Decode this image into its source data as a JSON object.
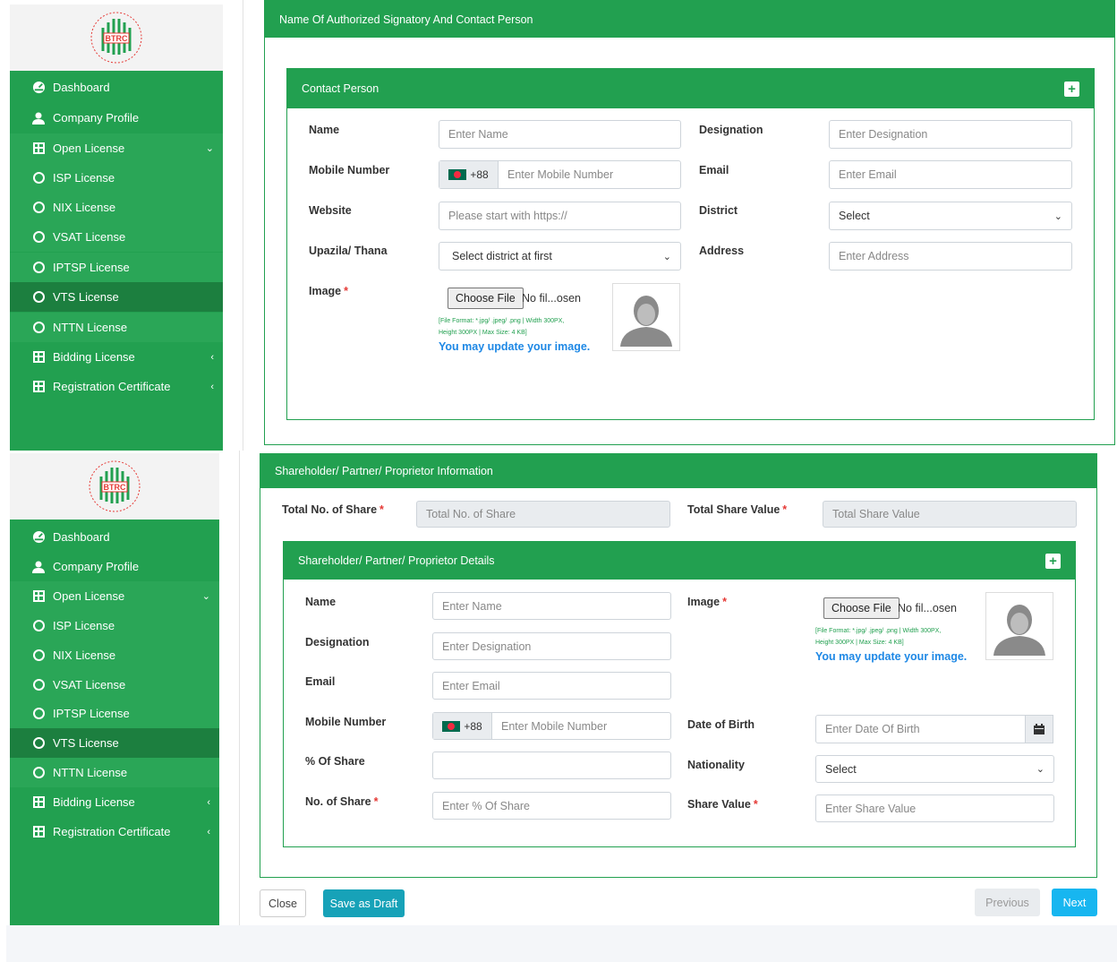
{
  "sidebar": {
    "logo_text": "BTRC",
    "items": [
      {
        "label": "Dashboard",
        "icon": "dashboard-icon"
      },
      {
        "label": "Company Profile",
        "icon": "user-icon"
      },
      {
        "label": "Open License",
        "icon": "plus-square-icon"
      },
      {
        "label": "ISP License",
        "icon": "circle-icon"
      },
      {
        "label": "NIX License",
        "icon": "circle-icon"
      },
      {
        "label": "VSAT License",
        "icon": "circle-icon"
      },
      {
        "label": "IPTSP License",
        "icon": "circle-icon"
      },
      {
        "label": "VTS License",
        "icon": "circle-icon"
      },
      {
        "label": "NTTN License",
        "icon": "circle-icon"
      },
      {
        "label": "Bidding License",
        "icon": "plus-square-icon"
      },
      {
        "label": "Registration Certificate",
        "icon": "plus-square-icon"
      }
    ]
  },
  "section1": {
    "title": "Name Of Authorized Signatory And Contact Person",
    "card_title": "Contact Person",
    "name_label": "Name",
    "name_placeholder": "Enter Name",
    "designation_label": "Designation",
    "designation_placeholder": "Enter Designation",
    "mobile_label": "Mobile Number",
    "country_code": "+88",
    "mobile_placeholder": "Enter Mobile Number",
    "email_label": "Email",
    "email_placeholder": "Enter Email",
    "website_label": "Website",
    "website_placeholder": "Please start with https://",
    "district_label": "District",
    "district_value": "Select",
    "upazila_label": "Upazila/ Thana",
    "upazila_value": "Select district at first",
    "address_label": "Address",
    "address_placeholder": "Enter Address",
    "image_label": "Image",
    "choose_file": "Choose File",
    "file_status": "No fil...osen",
    "hint_line1": "[File Format: *.jpg/ .jpeg/ .png | Width 300PX,",
    "hint_line2": "Height 300PX | Max Size: 4 KB]",
    "update_text": "You may update your image."
  },
  "section2": {
    "title": "Shareholder/ Partner/ Proprietor Information",
    "total_share_label": "Total No. of Share",
    "total_share_placeholder": "Total No. of Share",
    "total_value_label": "Total Share Value",
    "total_value_placeholder": "Total Share Value",
    "card_title": "Shareholder/ Partner/ Proprietor Details",
    "name_label": "Name",
    "name_placeholder": "Enter Name",
    "image_label": "Image",
    "choose_file": "Choose File",
    "file_status": "No fil...osen",
    "hint_line1": "[File Format: *.jpg/ .jpeg/ .png | Width 300PX,",
    "hint_line2": "Height 300PX | Max Size: 4 KB]",
    "update_text": "You may update your image.",
    "designation_label": "Designation",
    "designation_placeholder": "Enter Designation",
    "email_label": "Email",
    "email_placeholder": "Enter Email",
    "mobile_label": "Mobile Number",
    "country_code": "+88",
    "mobile_placeholder": "Enter Mobile Number",
    "dob_label": "Date of Birth",
    "dob_placeholder": "Enter Date Of Birth",
    "percent_label": "% Of Share",
    "percent_value": "",
    "nationality_label": "Nationality",
    "nationality_value": "Select",
    "no_share_label": "No. of Share",
    "no_share_placeholder": "Enter % Of Share",
    "share_value_label": "Share Value",
    "share_value_placeholder": "Enter Share Value"
  },
  "footer": {
    "close": "Close",
    "save_draft": "Save as Draft",
    "previous": "Previous",
    "next": "Next"
  },
  "colors": {
    "brand_green": "#22a050",
    "active_green": "#1c7f3f",
    "link_blue": "#1e88e5",
    "next_blue": "#17b6f0",
    "draft_teal": "#17a2b8"
  }
}
